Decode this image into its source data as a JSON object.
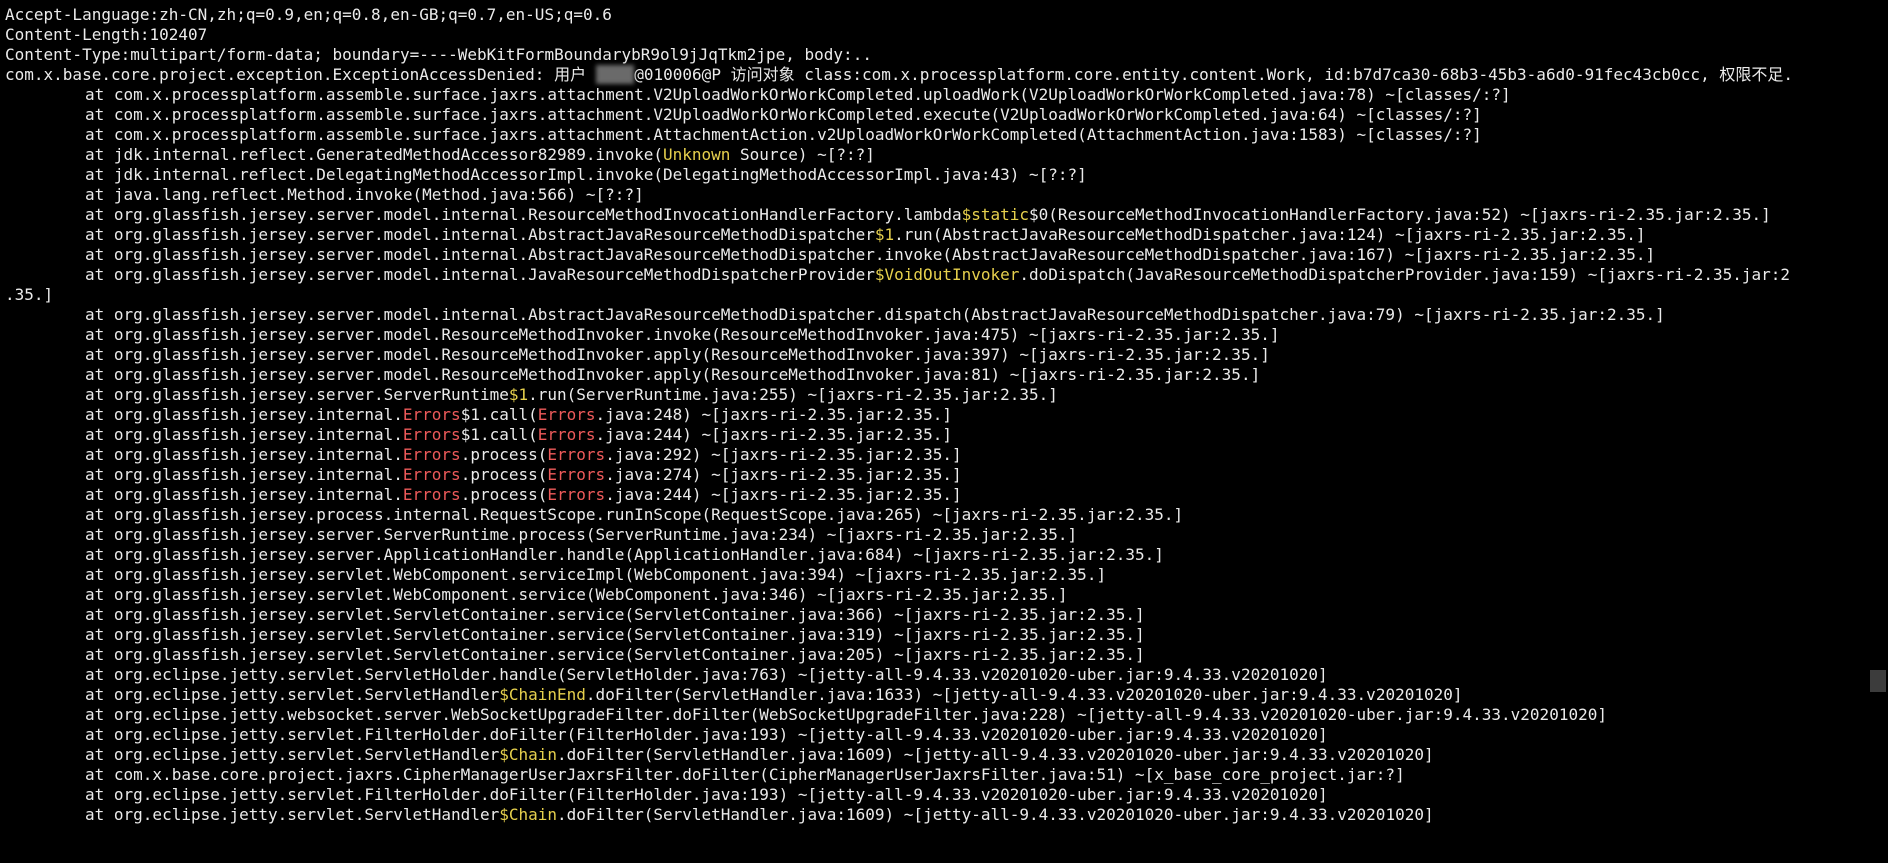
{
  "terminal": {
    "lines": [
      {
        "indent": false,
        "segs": [
          {
            "t": "Accept-Language:zh-CN,zh;q=0.9,en;q=0.8,en-GB;q=0.7,en-US;q=0.6"
          }
        ]
      },
      {
        "indent": false,
        "segs": [
          {
            "t": "Content-Length:102407"
          }
        ]
      },
      {
        "indent": false,
        "segs": [
          {
            "t": "Content-Type:multipart/form-data; boundary=----WebKitFormBoundarybR9ol9jJqTkm2jpe, body:.."
          }
        ]
      },
      {
        "indent": false,
        "segs": [
          {
            "t": "com.x.base.core.project.exception.ExceptionAccessDenied: 用户 "
          },
          {
            "t": "████",
            "c": "redact"
          },
          {
            "t": "@010006@P 访问对象 class:com.x.processplatform.core.entity.content.Work, id:b7d7ca30-68b3-45b3-a6d0-91fec43cb0cc, 权限不足."
          }
        ]
      },
      {
        "indent": true,
        "segs": [
          {
            "t": "at com.x.processplatform.assemble.surface.jaxrs.attachment.V2UploadWorkOrWorkCompleted.uploadWork(V2UploadWorkOrWorkCompleted.java:78) ~[classes/:?]"
          }
        ]
      },
      {
        "indent": true,
        "segs": [
          {
            "t": "at com.x.processplatform.assemble.surface.jaxrs.attachment.V2UploadWorkOrWorkCompleted.execute(V2UploadWorkOrWorkCompleted.java:64) ~[classes/:?]"
          }
        ]
      },
      {
        "indent": true,
        "segs": [
          {
            "t": "at com.x.processplatform.assemble.surface.jaxrs.attachment.AttachmentAction.v2UploadWorkOrWorkCompleted(AttachmentAction.java:1583) ~[classes/:?]"
          }
        ]
      },
      {
        "indent": true,
        "segs": [
          {
            "t": "at jdk.internal.reflect.GeneratedMethodAccessor82989.invoke("
          },
          {
            "t": "Unknown",
            "c": "hl-yellow"
          },
          {
            "t": " Source) ~[?:?]"
          }
        ]
      },
      {
        "indent": true,
        "segs": [
          {
            "t": "at jdk.internal.reflect.DelegatingMethodAccessorImpl.invoke(DelegatingMethodAccessorImpl.java:43) ~[?:?]"
          }
        ]
      },
      {
        "indent": true,
        "segs": [
          {
            "t": "at java.lang.reflect.Method.invoke(Method.java:566) ~[?:?]"
          }
        ]
      },
      {
        "indent": true,
        "segs": [
          {
            "t": "at org.glassfish.jersey.server.model.internal.ResourceMethodInvocationHandlerFactory.lambda"
          },
          {
            "t": "$static",
            "c": "hl-yellow"
          },
          {
            "t": "$0(ResourceMethodInvocationHandlerFactory.java:52) ~[jaxrs-ri-2.35.jar:2.35.]"
          }
        ]
      },
      {
        "indent": true,
        "segs": [
          {
            "t": "at org.glassfish.jersey.server.model.internal.AbstractJavaResourceMethodDispatcher"
          },
          {
            "t": "$1",
            "c": "hl-yellow"
          },
          {
            "t": ".run(AbstractJavaResourceMethodDispatcher.java:124) ~[jaxrs-ri-2.35.jar:2.35.]"
          }
        ]
      },
      {
        "indent": true,
        "segs": [
          {
            "t": "at org.glassfish.jersey.server.model.internal.AbstractJavaResourceMethodDispatcher.invoke(AbstractJavaResourceMethodDispatcher.java:167) ~[jaxrs-ri-2.35.jar:2.35.]"
          }
        ]
      },
      {
        "indent": true,
        "segs": [
          {
            "t": "at org.glassfish.jersey.server.model.internal.JavaResourceMethodDispatcherProvider"
          },
          {
            "t": "$VoidOutInvoker",
            "c": "hl-yellow"
          },
          {
            "t": ".doDispatch(JavaResourceMethodDispatcherProvider.java:159) ~[jaxrs-ri-2.35.jar:2"
          }
        ]
      },
      {
        "indent": false,
        "segs": [
          {
            "t": ".35.]"
          }
        ]
      },
      {
        "indent": true,
        "segs": [
          {
            "t": "at org.glassfish.jersey.server.model.internal.AbstractJavaResourceMethodDispatcher.dispatch(AbstractJavaResourceMethodDispatcher.java:79) ~[jaxrs-ri-2.35.jar:2.35.]"
          }
        ]
      },
      {
        "indent": true,
        "segs": [
          {
            "t": "at org.glassfish.jersey.server.model.ResourceMethodInvoker.invoke(ResourceMethodInvoker.java:475) ~[jaxrs-ri-2.35.jar:2.35.]"
          }
        ]
      },
      {
        "indent": true,
        "segs": [
          {
            "t": "at org.glassfish.jersey.server.model.ResourceMethodInvoker.apply(ResourceMethodInvoker.java:397) ~[jaxrs-ri-2.35.jar:2.35.]"
          }
        ]
      },
      {
        "indent": true,
        "segs": [
          {
            "t": "at org.glassfish.jersey.server.model.ResourceMethodInvoker.apply(ResourceMethodInvoker.java:81) ~[jaxrs-ri-2.35.jar:2.35.]"
          }
        ]
      },
      {
        "indent": true,
        "segs": [
          {
            "t": "at org.glassfish.jersey.server.ServerRuntime"
          },
          {
            "t": "$1",
            "c": "hl-yellow"
          },
          {
            "t": ".run(ServerRuntime.java:255) ~[jaxrs-ri-2.35.jar:2.35.]"
          }
        ]
      },
      {
        "indent": true,
        "segs": [
          {
            "t": "at org.glassfish.jersey.internal."
          },
          {
            "t": "Errors",
            "c": "hl-red"
          },
          {
            "t": "$1.call("
          },
          {
            "t": "Errors",
            "c": "hl-red"
          },
          {
            "t": ".java:248) ~[jaxrs-ri-2.35.jar:2.35.]"
          }
        ]
      },
      {
        "indent": true,
        "segs": [
          {
            "t": "at org.glassfish.jersey.internal."
          },
          {
            "t": "Errors",
            "c": "hl-red"
          },
          {
            "t": "$1.call("
          },
          {
            "t": "Errors",
            "c": "hl-red"
          },
          {
            "t": ".java:244) ~[jaxrs-ri-2.35.jar:2.35.]"
          }
        ]
      },
      {
        "indent": true,
        "segs": [
          {
            "t": "at org.glassfish.jersey.internal."
          },
          {
            "t": "Errors",
            "c": "hl-red"
          },
          {
            "t": ".process("
          },
          {
            "t": "Errors",
            "c": "hl-red"
          },
          {
            "t": ".java:292) ~[jaxrs-ri-2.35.jar:2.35.]"
          }
        ]
      },
      {
        "indent": true,
        "segs": [
          {
            "t": "at org.glassfish.jersey.internal."
          },
          {
            "t": "Errors",
            "c": "hl-red"
          },
          {
            "t": ".process("
          },
          {
            "t": "Errors",
            "c": "hl-red"
          },
          {
            "t": ".java:274) ~[jaxrs-ri-2.35.jar:2.35.]"
          }
        ]
      },
      {
        "indent": true,
        "segs": [
          {
            "t": "at org.glassfish.jersey.internal."
          },
          {
            "t": "Errors",
            "c": "hl-red"
          },
          {
            "t": ".process("
          },
          {
            "t": "Errors",
            "c": "hl-red"
          },
          {
            "t": ".java:244) ~[jaxrs-ri-2.35.jar:2.35.]"
          }
        ]
      },
      {
        "indent": true,
        "segs": [
          {
            "t": "at org.glassfish.jersey.process.internal.RequestScope.runInScope(RequestScope.java:265) ~[jaxrs-ri-2.35.jar:2.35.]"
          }
        ]
      },
      {
        "indent": true,
        "segs": [
          {
            "t": "at org.glassfish.jersey.server.ServerRuntime.process(ServerRuntime.java:234) ~[jaxrs-ri-2.35.jar:2.35.]"
          }
        ]
      },
      {
        "indent": true,
        "segs": [
          {
            "t": "at org.glassfish.jersey.server.ApplicationHandler.handle(ApplicationHandler.java:684) ~[jaxrs-ri-2.35.jar:2.35.]"
          }
        ]
      },
      {
        "indent": true,
        "segs": [
          {
            "t": "at org.glassfish.jersey.servlet.WebComponent.serviceImpl(WebComponent.java:394) ~[jaxrs-ri-2.35.jar:2.35.]"
          }
        ]
      },
      {
        "indent": true,
        "segs": [
          {
            "t": "at org.glassfish.jersey.servlet.WebComponent.service(WebComponent.java:346) ~[jaxrs-ri-2.35.jar:2.35.]"
          }
        ]
      },
      {
        "indent": true,
        "segs": [
          {
            "t": "at org.glassfish.jersey.servlet.ServletContainer.service(ServletContainer.java:366) ~[jaxrs-ri-2.35.jar:2.35.]"
          }
        ]
      },
      {
        "indent": true,
        "segs": [
          {
            "t": "at org.glassfish.jersey.servlet.ServletContainer.service(ServletContainer.java:319) ~[jaxrs-ri-2.35.jar:2.35.]"
          }
        ]
      },
      {
        "indent": true,
        "segs": [
          {
            "t": "at org.glassfish.jersey.servlet.ServletContainer.service(ServletContainer.java:205) ~[jaxrs-ri-2.35.jar:2.35.]"
          }
        ]
      },
      {
        "indent": true,
        "segs": [
          {
            "t": "at org.eclipse.jetty.servlet.ServletHolder.handle(ServletHolder.java:763) ~[jetty-all-9.4.33.v20201020-uber.jar:9.4.33.v20201020]"
          }
        ]
      },
      {
        "indent": true,
        "segs": [
          {
            "t": "at org.eclipse.jetty.servlet.ServletHandler"
          },
          {
            "t": "$ChainEnd",
            "c": "hl-yellow"
          },
          {
            "t": ".doFilter(ServletHandler.java:1633) ~[jetty-all-9.4.33.v20201020-uber.jar:9.4.33.v20201020]"
          }
        ]
      },
      {
        "indent": true,
        "segs": [
          {
            "t": "at org.eclipse.jetty.websocket.server.WebSocketUpgradeFilter.doFilter(WebSocketUpgradeFilter.java:228) ~[jetty-all-9.4.33.v20201020-uber.jar:9.4.33.v20201020]"
          }
        ]
      },
      {
        "indent": true,
        "segs": [
          {
            "t": "at org.eclipse.jetty.servlet.FilterHolder.doFilter(FilterHolder.java:193) ~[jetty-all-9.4.33.v20201020-uber.jar:9.4.33.v20201020]"
          }
        ]
      },
      {
        "indent": true,
        "segs": [
          {
            "t": "at org.eclipse.jetty.servlet.ServletHandler"
          },
          {
            "t": "$Chain",
            "c": "hl-yellow"
          },
          {
            "t": ".doFilter(ServletHandler.java:1609) ~[jetty-all-9.4.33.v20201020-uber.jar:9.4.33.v20201020]"
          }
        ]
      },
      {
        "indent": true,
        "segs": [
          {
            "t": "at com.x.base.core.project.jaxrs.CipherManagerUserJaxrsFilter.doFilter(CipherManagerUserJaxrsFilter.java:51) ~[x_base_core_project.jar:?]"
          }
        ]
      },
      {
        "indent": true,
        "segs": [
          {
            "t": "at org.eclipse.jetty.servlet.FilterHolder.doFilter(FilterHolder.java:193) ~[jetty-all-9.4.33.v20201020-uber.jar:9.4.33.v20201020]"
          }
        ]
      },
      {
        "indent": true,
        "segs": [
          {
            "t": "at org.eclipse.jetty.servlet.ServletHandler"
          },
          {
            "t": "$Chain",
            "c": "hl-yellow"
          },
          {
            "t": ".doFilter(ServletHandler.java:1609) ~[jetty-all-9.4.33.v20201020-uber.jar:9.4.33.v20201020]"
          }
        ]
      }
    ]
  },
  "colors": {
    "background": "#000000",
    "text": "#ebebeb",
    "highlight_yellow": "#e6d04d",
    "highlight_red": "#ee5a5a",
    "scroll_thumb": "#3c3c3c"
  }
}
